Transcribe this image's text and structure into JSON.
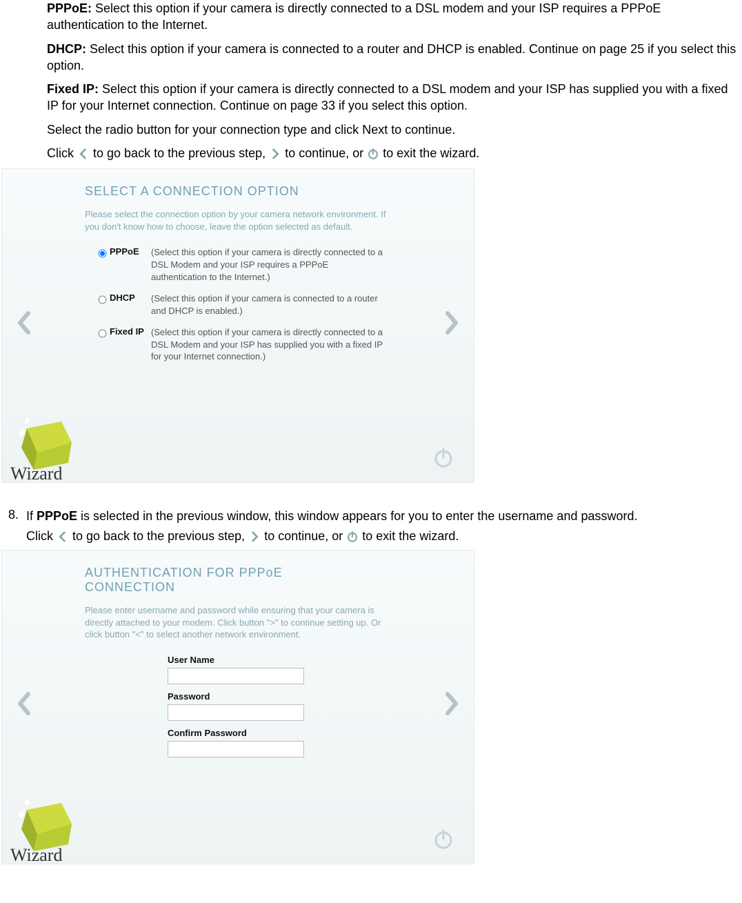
{
  "intro": {
    "pppoe_label": "PPPoE:",
    "pppoe_text": " Select this option if your camera is directly connected to a DSL modem and your ISP requires a PPPoE authentication to the Internet.",
    "dhcp_label": "DHCP:",
    "dhcp_text": " Select this option if your camera is connected to a router and DHCP is enabled. Continue on page 25 if you select this option.",
    "fixed_label": "Fixed IP:",
    "fixed_text": " Select this option if your camera is directly connected to a DSL modem and your ISP has supplied you with a fixed IP for your Internet connection. Continue on page 33 if you select this option.",
    "radio_hint": "Select the radio button for your connection type and click Next to continue.",
    "click_prefix": "Click ",
    "back_text": "to go back to the previous step, ",
    "cont_text": " to continue, or ",
    "exit_text": " to exit the wizard."
  },
  "wizard1": {
    "title": "SELECT A CONNECTION OPTION",
    "subtitle": "Please select the connection option by your camera network environment. If you don't know how to choose, leave the option selected as default.",
    "options": [
      {
        "label": "PPPoE",
        "desc": "(Select this option if your camera is directly connected to a DSL Modem and your ISP requires a PPPoE authentication to the Internet.)",
        "checked": true
      },
      {
        "label": "DHCP",
        "desc": "(Select this option if your camera is connected to a router and DHCP is enabled.)",
        "checked": false
      },
      {
        "label": "Fixed IP",
        "desc": "(Select this option if your camera is directly connected to a DSL Modem and your ISP has supplied you with a fixed IP for your Internet connection.)",
        "checked": false
      }
    ]
  },
  "step8": {
    "num": "8.",
    "line1a": "If ",
    "line1b": "PPPoE",
    "line1c": " is selected in the previous window, this window appears for you to enter the username and password.",
    "click_prefix": "Click ",
    "back_text": "to go back to the previous step, ",
    "cont_text": " to continue, or ",
    "exit_text": " to exit the wizard."
  },
  "wizard2": {
    "title": "AUTHENTICATION FOR PPPoE CONNECTION",
    "subtitle": "Please enter username and password while ensuring that your camera is directly attached to your modem. Click button \">\" to continue setting up. Or click button \"<\" to select another network environment.",
    "fields": {
      "username_label": "User Name",
      "username_value": "",
      "password_label": "Password",
      "password_value": "",
      "confirm_label": "Confirm Password",
      "confirm_value": ""
    }
  },
  "logo_text": "Wizard"
}
